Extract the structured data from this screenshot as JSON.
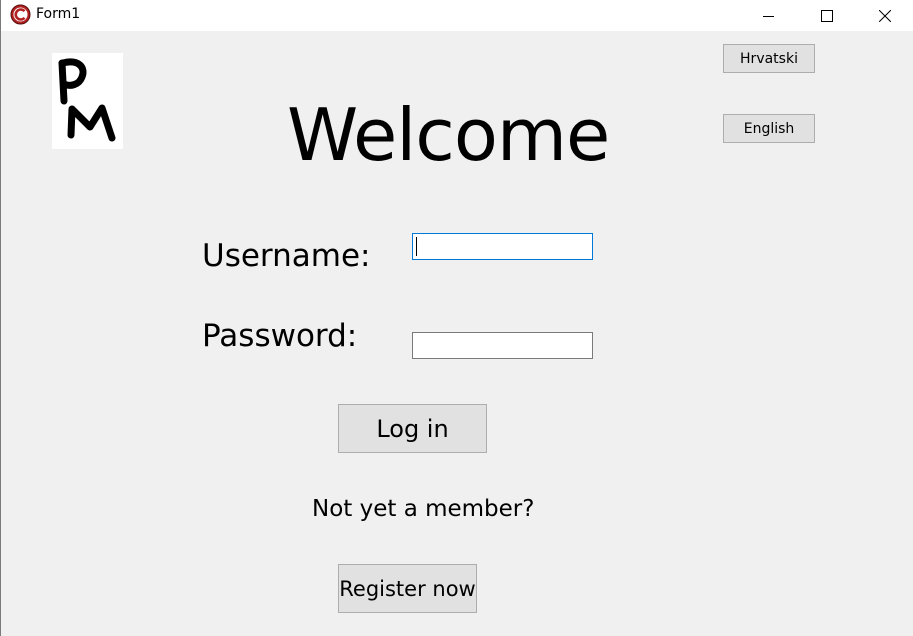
{
  "window": {
    "title": "Form1"
  },
  "language": {
    "croatian_label": "Hrvatski",
    "english_label": "English"
  },
  "logo": {
    "text": "PM"
  },
  "main": {
    "welcome": "Welcome",
    "username_label": "Username:",
    "username_value": "",
    "password_label": "Password:",
    "password_value": "",
    "login_label": "Log in",
    "not_member_text": "Not yet a member?",
    "register_label": "Register now"
  },
  "colors": {
    "background": "#f0f0f0",
    "button_face": "#e1e1e1",
    "focus_border": "#0078d7",
    "app_icon": "#b22222"
  }
}
